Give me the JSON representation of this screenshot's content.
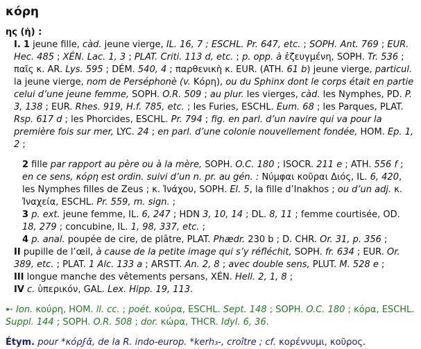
{
  "headword": "κόρη",
  "gender": "ης (ἡ) :",
  "senses": {
    "I_label": "I.",
    "s1": {
      "num": "1",
      "p1": "jeune fille, ",
      "p2": "càd.",
      "p3": " jeune vierge, ",
      "p4": "IL. 16, 7 ; ESCHL. Pr. 647, etc.",
      "p5": " ; ",
      "p6": "SOPH. Ant. 769",
      "p7": " ; ",
      "p8": "EUR. Hec. 485",
      "p9": " ; ",
      "p10": "XÉN. Lac. 1, 3",
      "p11": " ; ",
      "p12": "PLAT. Criti. 113 d, etc.",
      "p13": " ; ",
      "p14": "p. opp. à",
      "p15": " ἐζευγμένη, SOPH. ",
      "p16": "Tr. 536",
      "p17": " ; παῖς κ. AR. ",
      "p18": "Lys. 595",
      "p19": " ; DÉM. ",
      "p20": "540, 4",
      "p21": " ; παρθενικὴ κ. EUR. (ATH. ",
      "p22": "61 b",
      "p23": ") jeune vierge, ",
      "p24": "particul.",
      "p25": " la jeune vierge, ",
      "p26": "nom de Perséphonè (v.",
      "p27": " Κόρη), ",
      "p28": "ou du Sphinx dont le corps était en partie celui d’une jeune femme,",
      "p29": " SOPH. ",
      "p30": "O.R. 509",
      "p31": " ; ",
      "p32": "au plur.",
      "p33": " les vierges, ",
      "p34": "càd.",
      "p35": " les Nymphes, PD. ",
      "p36": "P. 3, 138",
      "p37": " ; EUR. ",
      "p38": "Rhes. 919, H.f. 785, etc.",
      "p39": " ; les Furies, ESCHL. ",
      "p40": "Eum. 68",
      "p41": " ; les Parques, PLAT. ",
      "p42": "Rsp. 617 d",
      "p43": " ; les Phorcides, ESCHL. ",
      "p44": "Pr. 794",
      "p45": " ; ",
      "p46": "fig. en parl. d’un navire qui va pour la première fois sur mer,",
      "p47": " LYC. ",
      "p48": "24",
      "p49": " ; ",
      "p50": "en parl. d’une colonie nouvellement fondée,",
      "p51": " HOM. ",
      "p52": "Ep. 1, 2",
      "p53": " ;"
    },
    "s2": {
      "num": "2",
      "p1": " fille ",
      "p2": "par rapport au père ou à la mère,",
      "p3": " SOPH. ",
      "p4": "O.C. 180",
      "p5": " ; ISOCR. ",
      "p6": "211 e",
      "p7": " ; ATH. ",
      "p8": "556 f",
      "p9": " ; ",
      "p10": "en ce sens, κόρη est ordin. suivi d’un n. pr. au gén. :",
      "p11": " Νύμφαι κοῦραι Διός, IL. ",
      "p12": "6, 420",
      "p13": ", les Nymphes filles de Zeus ; κ. Ἰνάχου, SOPH. ",
      "p14": "El. 5",
      "p15": ", la fille d’Inakhos ; ",
      "p16": "ou d’un adj.",
      "p17": " κ. Ἰναχεία, ESCHL. ",
      "p18": "Pr. 559, m. sign.",
      "p19": " ;"
    },
    "s3": {
      "num": "3",
      "p1": " ",
      "p2": "p. ext.",
      "p3": " jeune femme, IL. ",
      "p4": "6, 247",
      "p5": " ; HDN ",
      "p6": "3, 10, 14",
      "p7": " ; DL. ",
      "p8": "8, 11",
      "p9": " ; femme courtisée, OD. ",
      "p10": "18, 279",
      "p11": " ; concubine, IL. ",
      "p12": "1, 98, 337, etc.",
      "p13": " ;"
    },
    "s4": {
      "num": "4",
      "p1": " ",
      "p2": "p. anal.",
      "p3": " poupée de cire, de plâtre, PLAT. ",
      "p4": "Phædr.",
      "p5": " 230 b ; D. CHR. ",
      "p6": "Or. 31, p. 356",
      "p7": " ;"
    },
    "II": {
      "num": "II",
      "p1": " pupille de l’œil, ",
      "p2": "à cause de la petite image qui s’y réfléchit,",
      "p3": " SOPH. ",
      "p4": "fr. 634",
      "p5": " ; EUR. ",
      "p6": "Or. 389, etc.",
      "p7": " ; PLAT. ",
      "p8": "1 Alc. 133 a",
      "p9": " ; ARSTT. ",
      "p10": "An. 2, 8",
      "p11": " ; ",
      "p12": "avec double sens,",
      "p13": " PLUT. ",
      "p14": "M. 528 e",
      "p15": " ;"
    },
    "III": {
      "num": "III",
      "p1": " longue manche des vêtements persans, XÉN. ",
      "p2": "Hell. 2, 1, 8",
      "p3": " ;"
    },
    "IV": {
      "num": "IV",
      "p1": " ",
      "p2": "c.",
      "p3": " ὑπερικόν, GAL. ",
      "p4": "Lex. Hipp. 19, 113",
      "p5": "."
    }
  },
  "dialects": {
    "arrow": "➸",
    "p1": " Ion.",
    "p2": " κούρη, HOM. ",
    "p3": "ll. cc.",
    "p4": " ; ",
    "p5": "poét.",
    "p6": " κούρα, ESCHL. ",
    "p7": "Sept. 148",
    "p8": " ; SOPH. ",
    "p9": "O.C. 180",
    "p10": " ; κόρα, ESCHL. ",
    "p11": "Suppl. 144",
    "p12": " ; SOPH. ",
    "p13": "O.R. 508",
    "p14": " ; ",
    "p15": "dor.",
    "p16": " κώρα, THCR. ",
    "p17": "Idyl. 6, 36",
    "p18": "."
  },
  "etym": {
    "label": "Étym.",
    "p1": " pour *κόρϝᾱ, de la R. indo-europ. *kerh₃-, croître ; cf.",
    "p2": " κορέννυμι, κοῦρος."
  }
}
